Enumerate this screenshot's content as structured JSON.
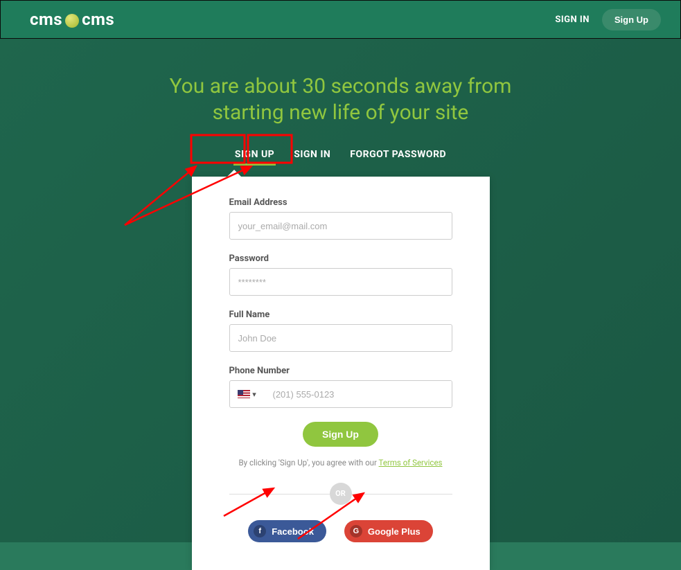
{
  "brand": {
    "part1": "cms",
    "part2": "cms"
  },
  "header": {
    "signin_label": "SIGN IN",
    "signup_label": "Sign Up"
  },
  "headline_line1": "You are about 30 seconds away from",
  "headline_line2": "starting new life of your site",
  "tabs": {
    "signup": "SIGN UP",
    "signin": "SIGN IN",
    "forgot": "FORGOT PASSWORD"
  },
  "form": {
    "email_label": "Email Address",
    "email_placeholder": "your_email@mail.com",
    "password_label": "Password",
    "password_placeholder": "********",
    "fullname_label": "Full Name",
    "fullname_placeholder": "John Doe",
    "phone_label": "Phone Number",
    "phone_placeholder": "(201) 555-0123",
    "submit_label": "Sign Up"
  },
  "tos": {
    "prefix": "By clicking 'Sign Up', you agree with our ",
    "link": "Terms of Services"
  },
  "divider_label": "OR",
  "social": {
    "facebook": "Facebook",
    "googleplus": "Google Plus"
  }
}
